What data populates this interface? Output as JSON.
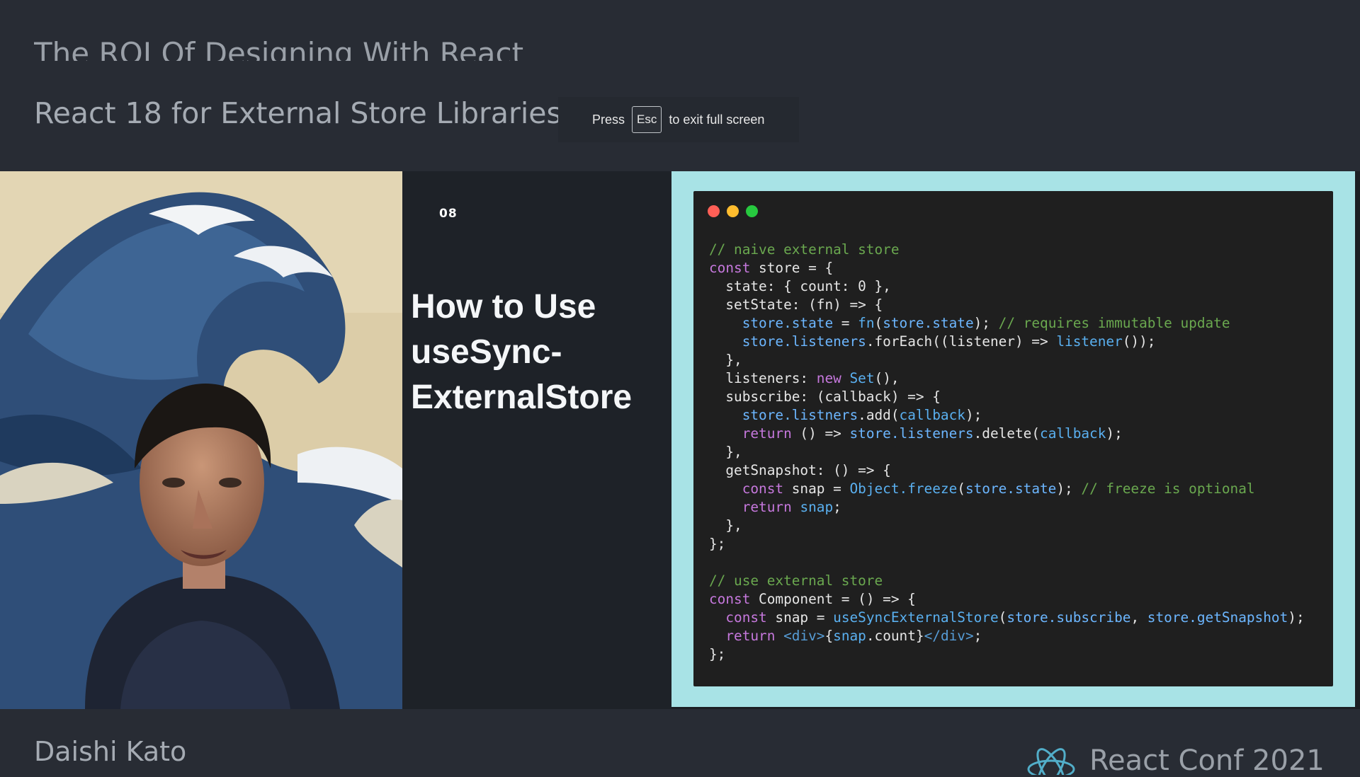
{
  "header": {
    "talk_title": "The ROI Of Designing With React",
    "session_title": "React 18 for External Store Libraries"
  },
  "fullscreen_toast": {
    "press": "Press",
    "key": "Esc",
    "rest": "to exit full screen"
  },
  "slide": {
    "number": "08",
    "heading_line1": "How to Use",
    "heading_line2": "useSync-",
    "heading_line3": "ExternalStore",
    "window_dots": [
      "#ff5f56",
      "#ffbd2e",
      "#27c93f"
    ],
    "code_lines": [
      "// naive external store",
      "const store = {",
      "  state: { count: 0 },",
      "  setState: (fn) => {",
      "    store.state = fn(store.state); // requires immutable update",
      "    store.listeners.forEach((listener) => listener());",
      "  },",
      "  listeners: new Set(),",
      "  subscribe: (callback) => {",
      "    store.listners.add(callback);",
      "    return () => store.listeners.delete(callback);",
      "  },",
      "  getSnapshot: () => {",
      "    const snap = Object.freeze(store.state); // freeze is optional",
      "    return snap;",
      "  },",
      "};",
      "",
      "// use external store",
      "const Component = () => {",
      "  const snap = useSyncExternalStore(store.subscribe, store.getSnapshot);",
      "  return <div>{snap.count}</div>;",
      "};"
    ]
  },
  "footer": {
    "speaker_name": "Daishi Kato",
    "conference": "React Conf 2021",
    "logo_icon": "react-atom-icon"
  },
  "colors": {
    "background": "#282c34",
    "slide_accent": "#a8e3e6",
    "code_bg": "#1f1f1f"
  }
}
